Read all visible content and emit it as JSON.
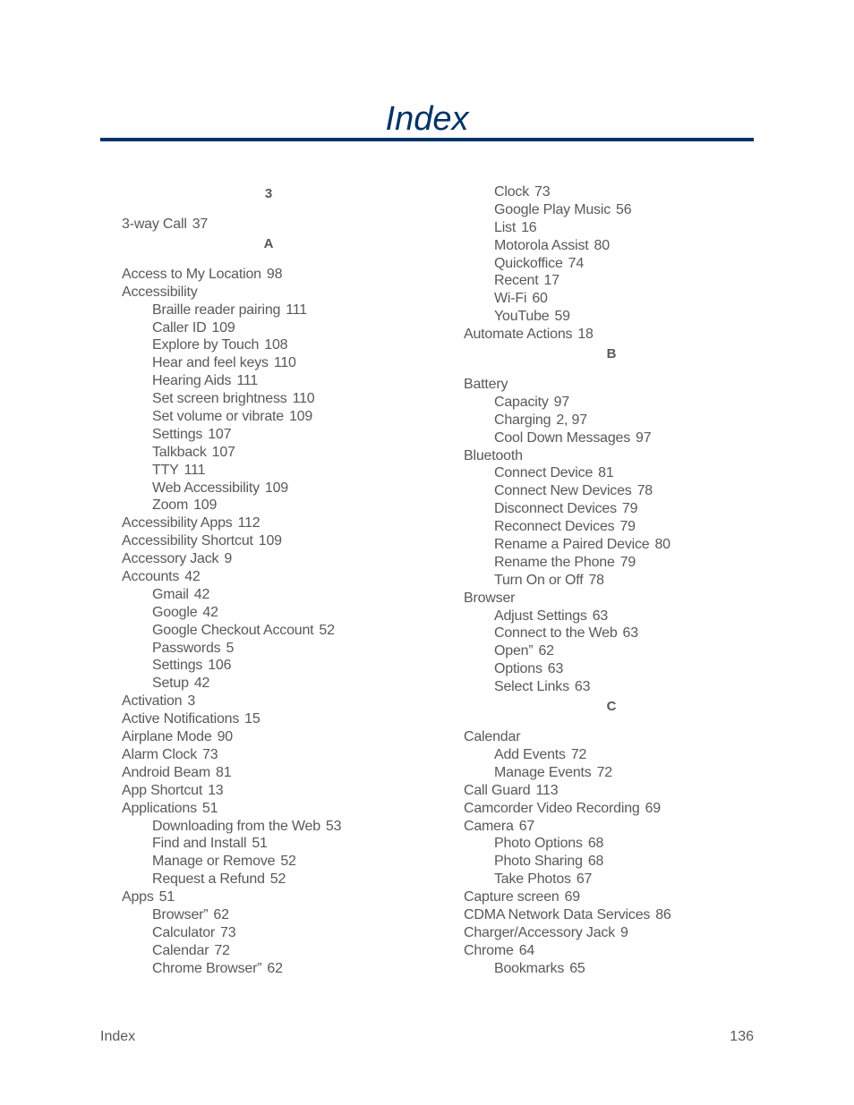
{
  "page": {
    "title": "Index",
    "colors": {
      "title": "#003366",
      "rule": "#003366",
      "text": "#595959"
    }
  },
  "footer": {
    "section": "Index",
    "page_number": "136"
  },
  "columns": [
    {
      "items": [
        {
          "type": "letter",
          "text": "3"
        },
        {
          "type": "entry",
          "level": 1,
          "term": "3-way Call",
          "pages": "37"
        },
        {
          "type": "letter",
          "text": "A"
        },
        {
          "type": "entry",
          "level": 1,
          "term": "Access to My Location",
          "pages": "98"
        },
        {
          "type": "entry",
          "level": 1,
          "term": "Accessibility",
          "pages": ""
        },
        {
          "type": "entry",
          "level": 2,
          "term": "Braille reader pairing",
          "pages": "111"
        },
        {
          "type": "entry",
          "level": 2,
          "term": "Caller ID",
          "pages": "109"
        },
        {
          "type": "entry",
          "level": 2,
          "term": "Explore by Touch",
          "pages": "108"
        },
        {
          "type": "entry",
          "level": 2,
          "term": "Hear and feel keys",
          "pages": "110"
        },
        {
          "type": "entry",
          "level": 2,
          "term": "Hearing Aids",
          "pages": "111"
        },
        {
          "type": "entry",
          "level": 2,
          "term": "Set screen brightness",
          "pages": "110"
        },
        {
          "type": "entry",
          "level": 2,
          "term": "Set volume or vibrate",
          "pages": "109"
        },
        {
          "type": "entry",
          "level": 2,
          "term": "Settings",
          "pages": "107"
        },
        {
          "type": "entry",
          "level": 2,
          "term": "Talkback",
          "pages": "107"
        },
        {
          "type": "entry",
          "level": 2,
          "term": "TTY",
          "pages": "111"
        },
        {
          "type": "entry",
          "level": 2,
          "term": "Web Accessibility",
          "pages": "109"
        },
        {
          "type": "entry",
          "level": 2,
          "term": "Zoom",
          "pages": "109"
        },
        {
          "type": "entry",
          "level": 1,
          "term": "Accessibility Apps",
          "pages": "112"
        },
        {
          "type": "entry",
          "level": 1,
          "term": "Accessibility Shortcut",
          "pages": "109"
        },
        {
          "type": "entry",
          "level": 1,
          "term": "Accessory Jack",
          "pages": "9"
        },
        {
          "type": "entry",
          "level": 1,
          "term": "Accounts",
          "pages": "42"
        },
        {
          "type": "entry",
          "level": 2,
          "term": "Gmail",
          "pages": "42"
        },
        {
          "type": "entry",
          "level": 2,
          "term": "Google",
          "pages": "42"
        },
        {
          "type": "entry",
          "level": 2,
          "term": "Google Checkout Account",
          "pages": "52"
        },
        {
          "type": "entry",
          "level": 2,
          "term": "Passwords",
          "pages": "5"
        },
        {
          "type": "entry",
          "level": 2,
          "term": "Settings",
          "pages": "106"
        },
        {
          "type": "entry",
          "level": 2,
          "term": "Setup",
          "pages": "42"
        },
        {
          "type": "entry",
          "level": 1,
          "term": "Activation",
          "pages": "3"
        },
        {
          "type": "entry",
          "level": 1,
          "term": "Active Notifications",
          "pages": "15"
        },
        {
          "type": "entry",
          "level": 1,
          "term": "Airplane Mode",
          "pages": "90"
        },
        {
          "type": "entry",
          "level": 1,
          "term": "Alarm Clock",
          "pages": "73"
        },
        {
          "type": "entry",
          "level": 1,
          "term": "Android Beam",
          "pages": "81"
        },
        {
          "type": "entry",
          "level": 1,
          "term": "App Shortcut",
          "pages": "13"
        },
        {
          "type": "entry",
          "level": 1,
          "term": "Applications",
          "pages": "51"
        },
        {
          "type": "entry",
          "level": 2,
          "term": "Downloading from the Web",
          "pages": "53"
        },
        {
          "type": "entry",
          "level": 2,
          "term": "Find and Install",
          "pages": "51"
        },
        {
          "type": "entry",
          "level": 2,
          "term": "Manage or Remove",
          "pages": "52"
        },
        {
          "type": "entry",
          "level": 2,
          "term": "Request a Refund",
          "pages": "52"
        },
        {
          "type": "entry",
          "level": 1,
          "term": "Apps",
          "pages": "51"
        },
        {
          "type": "entry",
          "level": 2,
          "term": "Browser”",
          "pages": "62"
        },
        {
          "type": "entry",
          "level": 2,
          "term": "Calculator",
          "pages": "73"
        },
        {
          "type": "entry",
          "level": 2,
          "term": "Calendar",
          "pages": "72"
        },
        {
          "type": "entry",
          "level": 2,
          "term": "Chrome Browser”",
          "pages": "62"
        }
      ]
    },
    {
      "items": [
        {
          "type": "entry",
          "level": 2,
          "term": "Clock",
          "pages": "73"
        },
        {
          "type": "entry",
          "level": 2,
          "term": "Google Play Music",
          "pages": "56"
        },
        {
          "type": "entry",
          "level": 2,
          "term": "List",
          "pages": "16"
        },
        {
          "type": "entry",
          "level": 2,
          "term": "Motorola Assist",
          "pages": "80"
        },
        {
          "type": "entry",
          "level": 2,
          "term": "Quickoffice",
          "pages": "74"
        },
        {
          "type": "entry",
          "level": 2,
          "term": "Recent",
          "pages": "17"
        },
        {
          "type": "entry",
          "level": 2,
          "term": "Wi-Fi",
          "pages": "60"
        },
        {
          "type": "entry",
          "level": 2,
          "term": "YouTube",
          "pages": "59"
        },
        {
          "type": "entry",
          "level": 1,
          "term": "Automate Actions",
          "pages": "18"
        },
        {
          "type": "letter",
          "text": "B"
        },
        {
          "type": "entry",
          "level": 1,
          "term": "Battery",
          "pages": ""
        },
        {
          "type": "entry",
          "level": 2,
          "term": "Capacity",
          "pages": "97"
        },
        {
          "type": "entry",
          "level": 2,
          "term": "Charging",
          "pages": "2, 97"
        },
        {
          "type": "entry",
          "level": 2,
          "term": "Cool Down Messages",
          "pages": "97"
        },
        {
          "type": "entry",
          "level": 1,
          "term": "Bluetooth",
          "pages": ""
        },
        {
          "type": "entry",
          "level": 2,
          "term": "Connect Device",
          "pages": "81"
        },
        {
          "type": "entry",
          "level": 2,
          "term": "Connect New Devices",
          "pages": "78"
        },
        {
          "type": "entry",
          "level": 2,
          "term": "Disconnect Devices",
          "pages": "79"
        },
        {
          "type": "entry",
          "level": 2,
          "term": "Reconnect Devices",
          "pages": "79"
        },
        {
          "type": "entry",
          "level": 2,
          "term": "Rename a Paired Device",
          "pages": "80"
        },
        {
          "type": "entry",
          "level": 2,
          "term": "Rename the Phone",
          "pages": "79"
        },
        {
          "type": "entry",
          "level": 2,
          "term": "Turn On or Off",
          "pages": "78"
        },
        {
          "type": "entry",
          "level": 1,
          "term": "Browser",
          "pages": ""
        },
        {
          "type": "entry",
          "level": 2,
          "term": "Adjust Settings",
          "pages": "63"
        },
        {
          "type": "entry",
          "level": 2,
          "term": "Connect to the Web",
          "pages": "63"
        },
        {
          "type": "entry",
          "level": 2,
          "term": "Open”",
          "pages": "62"
        },
        {
          "type": "entry",
          "level": 2,
          "term": "Options",
          "pages": "63"
        },
        {
          "type": "entry",
          "level": 2,
          "term": "Select Links",
          "pages": "63"
        },
        {
          "type": "letter",
          "text": "C"
        },
        {
          "type": "entry",
          "level": 1,
          "term": "Calendar",
          "pages": ""
        },
        {
          "type": "entry",
          "level": 2,
          "term": "Add Events",
          "pages": "72"
        },
        {
          "type": "entry",
          "level": 2,
          "term": "Manage Events",
          "pages": "72"
        },
        {
          "type": "entry",
          "level": 1,
          "term": "Call Guard",
          "pages": "113"
        },
        {
          "type": "entry",
          "level": 1,
          "term": "Camcorder Video Recording",
          "pages": "69"
        },
        {
          "type": "entry",
          "level": 1,
          "term": "Camera",
          "pages": "67"
        },
        {
          "type": "entry",
          "level": 2,
          "term": "Photo Options",
          "pages": "68"
        },
        {
          "type": "entry",
          "level": 2,
          "term": "Photo Sharing",
          "pages": "68"
        },
        {
          "type": "entry",
          "level": 2,
          "term": "Take Photos",
          "pages": "67"
        },
        {
          "type": "entry",
          "level": 1,
          "term": "Capture screen",
          "pages": "69"
        },
        {
          "type": "entry",
          "level": 1,
          "term": "CDMA Network Data Services",
          "pages": "86"
        },
        {
          "type": "entry",
          "level": 1,
          "term": "Charger/Accessory Jack",
          "pages": "9"
        },
        {
          "type": "entry",
          "level": 1,
          "term": "Chrome",
          "pages": "64"
        },
        {
          "type": "entry",
          "level": 2,
          "term": "Bookmarks",
          "pages": "65"
        }
      ]
    }
  ]
}
